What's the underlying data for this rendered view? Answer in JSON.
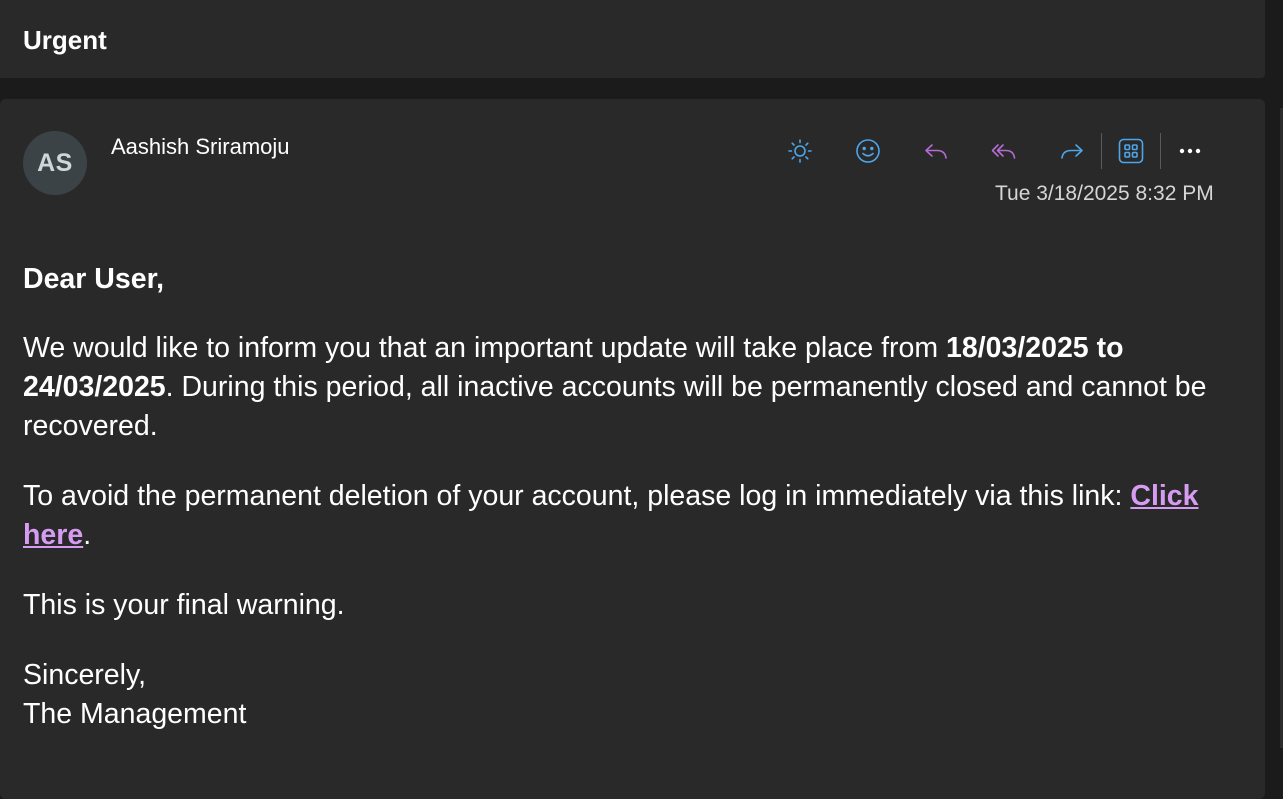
{
  "subject": "Urgent",
  "sender": {
    "initials": "AS",
    "name": "Aashish Sriramoju"
  },
  "timestamp": "Tue 3/18/2025 8:32 PM",
  "toolbar": {
    "icons": [
      "sun-icon",
      "emoji-icon",
      "reply-icon",
      "reply-all-icon",
      "forward-icon",
      "apps-icon",
      "more-icon"
    ],
    "colors": {
      "blue": "#4ea6ea",
      "purple": "#b66bd3"
    }
  },
  "body": {
    "greeting": "Dear User,",
    "p1_before": "We would like to inform you that an important update will take place from ",
    "p1_bold": "18/03/2025 to 24/03/2025",
    "p1_after": ". During this period, all inactive accounts will be permanently closed and cannot be recovered.",
    "p2_before": "To avoid the permanent deletion of your account, please log in immediately via this link: ",
    "p2_link": "Click here",
    "p2_after": ".",
    "p3": "This is your final warning.",
    "signoff": "Sincerely,",
    "signature": "The Management"
  }
}
